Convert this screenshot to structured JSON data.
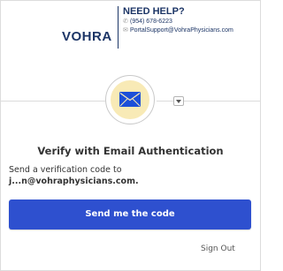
{
  "header": {
    "logo_text": "VOHRA",
    "help_title": "NEED HELP?",
    "phone_icon": "phone-icon",
    "phone": "(954) 678-6223",
    "mail_icon": "mail-icon",
    "support_email": "PortalSupport@VohraPhysicians.com"
  },
  "factor": {
    "icon": "envelope-icon",
    "dropdown_icon": "chevron-down-icon",
    "badge_color": "#f8eab6",
    "envelope_color": "#1c4fd8"
  },
  "main": {
    "title": "Verify with Email Authentication",
    "description": "Send a verification code to",
    "masked_email": "j...n@vohraphysicians.com."
  },
  "actions": {
    "send_label": "Send me the code",
    "send_color": "#2e50cf",
    "signout_label": "Sign Out"
  }
}
